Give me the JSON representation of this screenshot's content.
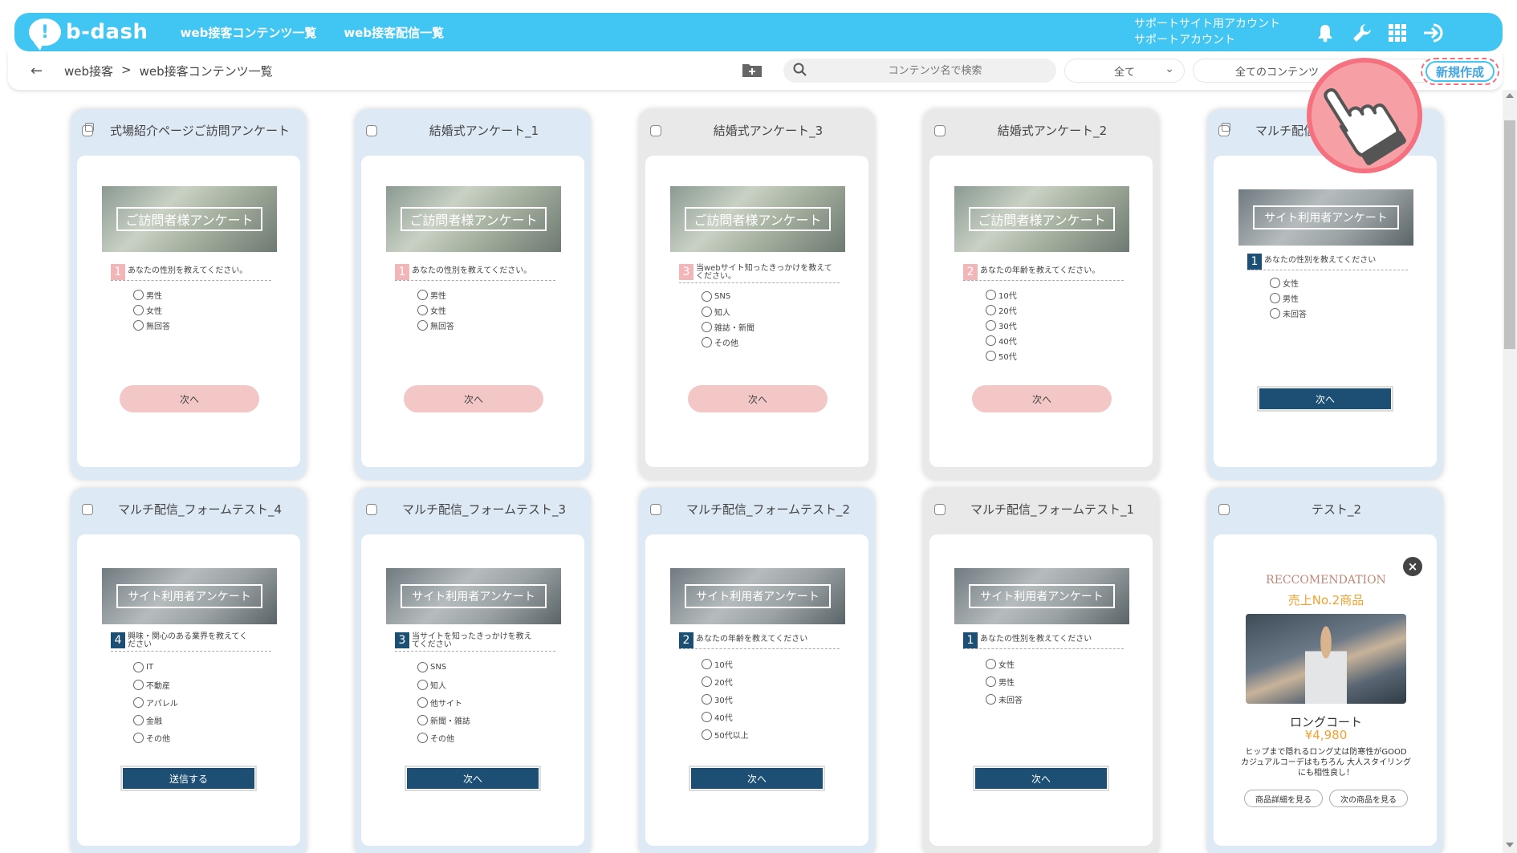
{
  "navbar": {
    "logo_text": "b-dash",
    "links": [
      "web接客コンテンツ一覧",
      "web接客配信一覧"
    ],
    "account_line1": "サポートサイト用アカウント",
    "account_line2": "サポートアカウント",
    "icons": [
      "bell-icon",
      "wrench-icon",
      "grid-icon",
      "logout-icon"
    ],
    "accent_color": "#41c6f4"
  },
  "subbar": {
    "breadcrumb": [
      "web接客",
      ">",
      "web接客コンテンツ一覧"
    ],
    "search_placeholder": "コンテンツ名で検索",
    "filter_all": "全て",
    "filter_content": "全てのコンテンツ",
    "new_button": "新規作成"
  },
  "cards": [
    {
      "title": "式場紹介ページご訪問アンケート",
      "style": "wedding",
      "bg": "blue",
      "banner": "ご訪問者様アンケート",
      "q_num": "1",
      "question": "あなたの性別を教えてください。",
      "options": [
        "男性",
        "女性",
        "無回答"
      ],
      "button": "次へ"
    },
    {
      "title": "結婚式アンケート_1",
      "style": "wedding",
      "bg": "blue",
      "banner": "ご訪問者様アンケート",
      "q_num": "1",
      "question": "あなたの性別を教えてください。",
      "options": [
        "男性",
        "女性",
        "無回答"
      ],
      "button": "次へ"
    },
    {
      "title": "結婚式アンケート_3",
      "style": "wedding",
      "bg": "grey",
      "banner": "ご訪問者様アンケート",
      "q_num": "3",
      "question": "当webサイト知ったきっかけを教えてください。",
      "options": [
        "SNS",
        "知人",
        "雑誌・新聞",
        "その他"
      ],
      "button": "次へ"
    },
    {
      "title": "結婚式アンケート_2",
      "style": "wedding",
      "bg": "grey",
      "banner": "ご訪問者様アンケート",
      "q_num": "2",
      "question": "あなたの年齢を教えてください。",
      "options": [
        "10代",
        "20代",
        "30代",
        "40代",
        "50代"
      ],
      "button": "次へ"
    },
    {
      "title": "マルチ配信",
      "style": "multi",
      "bg": "blue",
      "banner": "サイト利用者アンケート",
      "q_num": "1",
      "question": "あなたの性別を教えてください",
      "options": [
        "女性",
        "男性",
        "未回答"
      ],
      "button": "次へ"
    },
    {
      "title": "マルチ配信_フォームテスト_4",
      "style": "multi",
      "bg": "blue",
      "banner": "サイト利用者アンケート",
      "q_num": "4",
      "question": "興味・関心のある業界を教えてください",
      "options": [
        "IT",
        "不動産",
        "アパレル",
        "金融",
        "その他"
      ],
      "button": "送信する"
    },
    {
      "title": "マルチ配信_フォームテスト_3",
      "style": "multi",
      "bg": "blue",
      "banner": "サイト利用者アンケート",
      "q_num": "3",
      "question": "当サイトを知ったきっかけを教えてください",
      "options": [
        "SNS",
        "知人",
        "他サイト",
        "新聞・雑誌",
        "その他"
      ],
      "button": "次へ"
    },
    {
      "title": "マルチ配信_フォームテスト_2",
      "style": "multi",
      "bg": "blue",
      "banner": "サイト利用者アンケート",
      "q_num": "2",
      "question": "あなたの年齢を教えてください",
      "options": [
        "10代",
        "20代",
        "30代",
        "40代",
        "50代以上"
      ],
      "button": "次へ"
    },
    {
      "title": "マルチ配信_フォームテスト_1",
      "style": "multi",
      "bg": "grey",
      "banner": "サイト利用者アンケート",
      "q_num": "1",
      "question": "あなたの性別を教えてください",
      "options": [
        "女性",
        "男性",
        "未回答"
      ],
      "button": "次へ"
    },
    {
      "title": "テスト_2",
      "style": "rec",
      "bg": "blue",
      "rec_title": "RECCOMENDATION",
      "rec_sub": "売上No.2商品",
      "product": "ロングコート",
      "price": "¥4,980",
      "desc": "ヒップまで隠れるロング丈は防寒性がGOOD カジュアルコーデはもちろん 大人スタイリングにも相性良し！",
      "btn1": "商品詳細を見る",
      "btn2": "次の商品を見る"
    }
  ]
}
